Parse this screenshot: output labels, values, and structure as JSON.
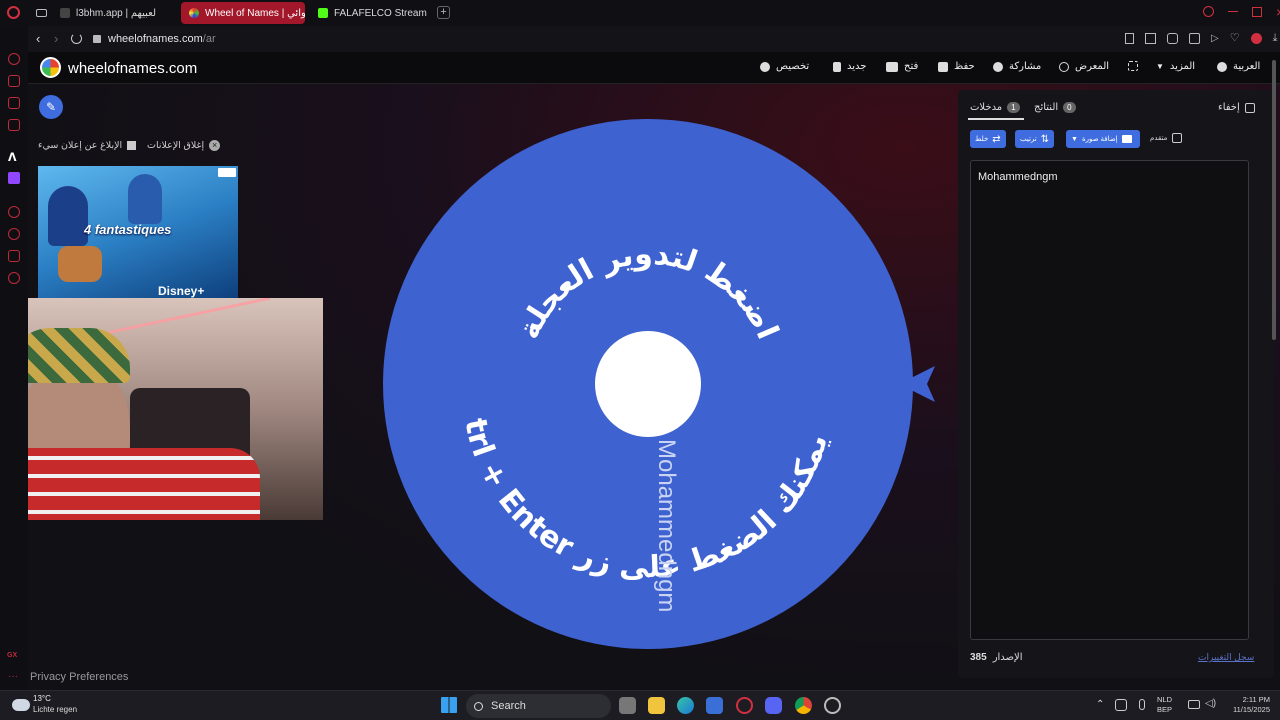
{
  "browser": {
    "tabs": [
      {
        "label": "l3bhm.app | لعبيهم",
        "active": false
      },
      {
        "label": "Wheel of Names | عشوائي",
        "active": true
      },
      {
        "label": "FALAFELCO Stream - Wat",
        "active": false
      }
    ],
    "address": {
      "host": "wheelofnames.com",
      "path": "/ar"
    }
  },
  "site": {
    "brand": "wheelofnames.com",
    "nav": {
      "customize": "تخصيص",
      "new": "جديد",
      "open": "فتح",
      "save": "حفظ",
      "share": "مشاركة",
      "gallery": "المعرض",
      "more": "المزيد",
      "language": "العربية"
    },
    "ads": {
      "close_ads": "إغلاق الإعلانات",
      "report_ad": "الإبلاغ عن إعلان سيء",
      "ad_title": "4 fantastiques",
      "ad_brand": "Disney+"
    },
    "privacy": "Privacy Preferences"
  },
  "wheel": {
    "color": "#3f62d1",
    "center_color": "#ffffff",
    "pointer_color": "#3f62d1",
    "text_top": "اضغط لتدوير العجلة",
    "text_bottom": "Ctrl + Enter أو يمكنك الضغط على زر",
    "entry_label": "Mohammedngm"
  },
  "panel": {
    "tab_entries": {
      "label": "مدخلات",
      "count": "1"
    },
    "tab_results": {
      "label": "النتائج",
      "count": "0"
    },
    "hide_label": "إخفاء",
    "shuffle": "خلط",
    "sort": "ترتيب",
    "add_image": "إضافة صورة",
    "advanced": "متقدم",
    "entries": [
      "Mohammedngm"
    ],
    "version_label": "الإصدار",
    "version_number": "385",
    "changelog": "سجل التغييرات"
  },
  "taskbar": {
    "weather_temp": "13°C",
    "weather_desc": "Lichte regen",
    "search_placeholder": "Search",
    "lang_top": "NLD",
    "lang_bottom": "BEP",
    "time": "2:11 PM",
    "date": "11/15/2025"
  }
}
